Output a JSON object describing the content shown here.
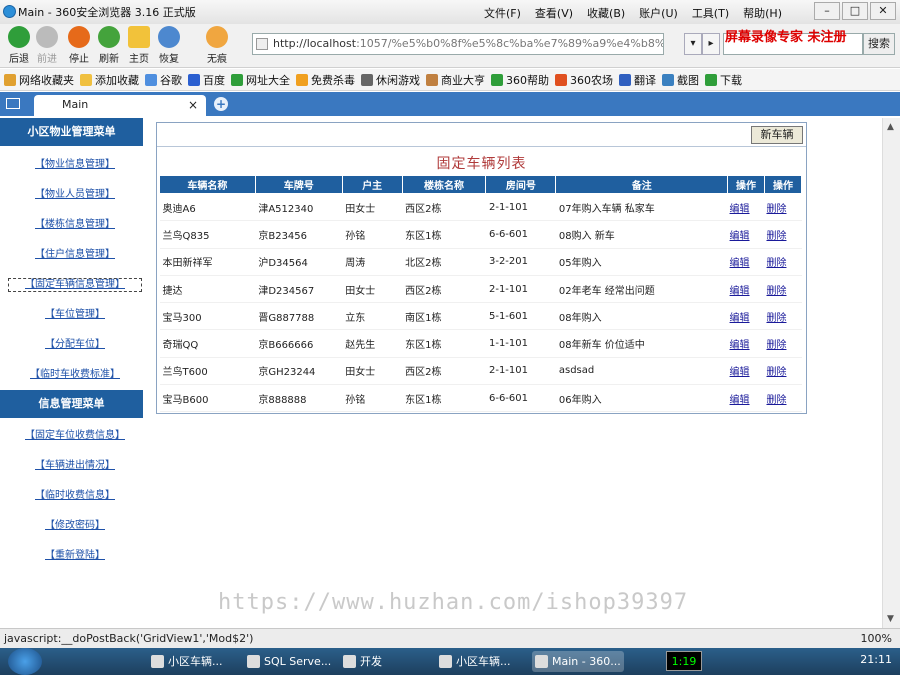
{
  "window": {
    "title": "Main - 360安全浏览器 3.16 正式版",
    "menus": [
      "文件(F)",
      "查看(V)",
      "收藏(B)",
      "账户(U)",
      "工具(T)",
      "帮助(H)"
    ]
  },
  "toolbar": {
    "back": "后退",
    "forward": "前进",
    "stop": "停止",
    "refresh": "刷新",
    "home": "主页",
    "restore": "恢复",
    "notrace": "无痕",
    "address_host": "http://localhost",
    "address_rest": ":1057/%e5%b0%8f%e5%8c%ba%e7%89%a9%e4%b8%9a",
    "search_button": "搜索",
    "overlay_text": "屏幕录像专家 未注册"
  },
  "favorites": [
    "网络收藏夹",
    "添加收藏",
    "谷歌",
    "百度",
    "网址大全",
    "免费杀毒",
    "休闲游戏",
    "商业大亨",
    "360帮助",
    "360农场",
    "翻译",
    "截图",
    "下载"
  ],
  "tab": {
    "label": "Main"
  },
  "sidebar": {
    "group1_title": "小区物业管理菜单",
    "group1": [
      "【物业信息管理】",
      "【物业人员管理】",
      "【楼栋信息管理】",
      "【住户信息管理】",
      "【固定车辆信息管理】",
      "【车位管理】",
      "【分配车位】",
      "【临时车收费标准】"
    ],
    "group2_title": "信息管理菜单",
    "group2": [
      "【固定车位收费信息】",
      "【车辆进出情况】",
      "【临时收费信息】",
      "【修改密码】",
      "【重新登陆】"
    ]
  },
  "main": {
    "new_button": "新车辆",
    "list_title": "固定车辆列表",
    "columns": [
      "车辆名称",
      "车牌号",
      "户主",
      "楼栋名称",
      "房间号",
      "备注",
      "操作",
      "操作"
    ],
    "rows": [
      [
        "奥迪A6",
        "津A512340",
        "田女士",
        "西区2栋",
        "2-1-101",
        "07年购入车辆 私家车",
        "编辑",
        "删除"
      ],
      [
        "兰鸟Q835",
        "京B23456",
        "孙铭",
        "东区1栋",
        "6-6-601",
        "08购入 新车",
        "编辑",
        "删除"
      ],
      [
        "本田新祥军",
        "沪D34564",
        "周涛",
        "北区2栋",
        "3-2-201",
        "05年购入",
        "编辑",
        "删除"
      ],
      [
        "捷达",
        "津D234567",
        "田女士",
        "西区2栋",
        "2-1-101",
        "02年老车 经常出问题",
        "编辑",
        "删除"
      ],
      [
        "宝马300",
        "晋G887788",
        "立东",
        "南区1栋",
        "5-1-601",
        "08年购入",
        "编辑",
        "删除"
      ],
      [
        "奇瑞QQ",
        "京B666666",
        "赵先生",
        "东区1栋",
        "1-1-101",
        "08年新车 价位适中",
        "编辑",
        "删除"
      ],
      [
        "兰鸟T600",
        "京GH23244",
        "田女士",
        "西区2栋",
        "2-1-101",
        "asdsad",
        "编辑",
        "删除"
      ],
      [
        "宝马B600",
        "京888888",
        "孙铭",
        "东区1栋",
        "6-6-601",
        "06年购入",
        "编辑",
        "删除"
      ]
    ]
  },
  "overlay_url": "https://www.huzhan.com/ishop39397",
  "status": {
    "text": "javascript:__doPostBack('GridView1','Mod$2')",
    "zoom": "100%"
  },
  "taskbar": {
    "items": [
      "小区车辆...",
      "SQL Serve...",
      "开发",
      "小区车辆...",
      "Main - 360..."
    ],
    "rec": "1:19",
    "clock": "21:11"
  }
}
